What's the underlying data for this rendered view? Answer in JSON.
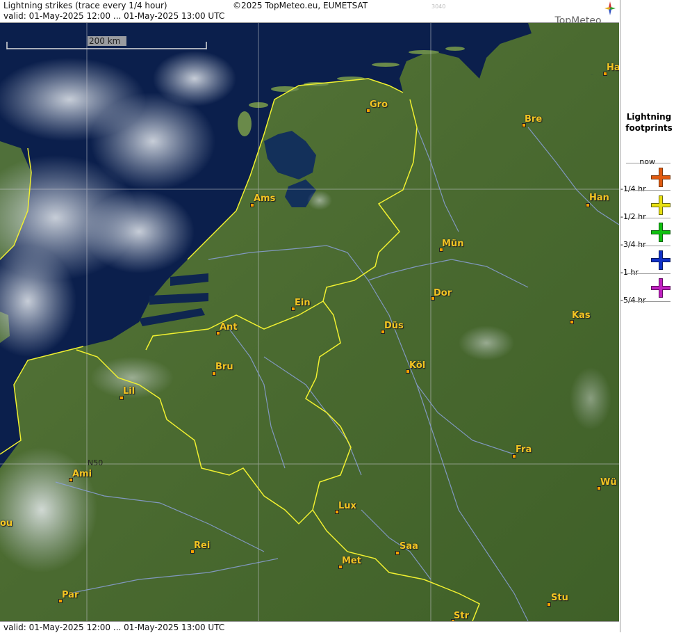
{
  "header": {
    "title": "Lightning strikes (trace every 1/4 hour)",
    "copyright": "©2025 TopMeteo.eu, EUMETSAT",
    "small_code": "3040",
    "valid": "valid:  01-May-2025 12:00 ... 01-May-2025 13:00 UTC",
    "logo": "TopMeteo"
  },
  "footer": {
    "valid": "valid:  01-May-2025 12:00 ... 01-May-2025 13:00 UTC"
  },
  "scale_bar": {
    "label": "200 km"
  },
  "grid_label": "N50",
  "cities": [
    {
      "id": "gro",
      "label": "Gro"
    },
    {
      "id": "bre",
      "label": "Bre"
    },
    {
      "id": "ha",
      "label": "Ha"
    },
    {
      "id": "ams",
      "label": "Ams"
    },
    {
      "id": "han",
      "label": "Han"
    },
    {
      "id": "mun",
      "label": "Mün"
    },
    {
      "id": "dor",
      "label": "Dor"
    },
    {
      "id": "ein",
      "label": "Ein"
    },
    {
      "id": "ant",
      "label": "Ant"
    },
    {
      "id": "dus",
      "label": "Düs"
    },
    {
      "id": "kas",
      "label": "Kas"
    },
    {
      "id": "bru",
      "label": "Bru"
    },
    {
      "id": "kol",
      "label": "Köl"
    },
    {
      "id": "lil",
      "label": "Lil"
    },
    {
      "id": "fra",
      "label": "Fra"
    },
    {
      "id": "ami",
      "label": "Ami"
    },
    {
      "id": "wu",
      "label": "Wü"
    },
    {
      "id": "lux",
      "label": "Lux"
    },
    {
      "id": "bou",
      "label": "ou"
    },
    {
      "id": "rei",
      "label": "Rei"
    },
    {
      "id": "saa",
      "label": "Saa"
    },
    {
      "id": "met",
      "label": "Met"
    },
    {
      "id": "par",
      "label": "Par"
    },
    {
      "id": "stu",
      "label": "Stu"
    },
    {
      "id": "str",
      "label": "Str"
    }
  ],
  "legend": {
    "title_line1": "Lightning",
    "title_line2": "footprints",
    "rows": [
      {
        "label": "now",
        "color": "#e05a10"
      },
      {
        "label": "-1/4 hr",
        "color": "#e8e010"
      },
      {
        "label": "-1/2 hr",
        "color": "#10c010"
      },
      {
        "label": "-3/4 hr",
        "color": "#1030c8"
      },
      {
        "label": "-1 hr",
        "color": "#c020c0"
      },
      {
        "label": "-5/4 hr",
        "color": ""
      }
    ]
  },
  "colors": {
    "sea": "#0a1f4a",
    "land": "#4a6a30",
    "border": "#f0f030",
    "river": "#8aa0d8",
    "city": "#f2c522"
  }
}
